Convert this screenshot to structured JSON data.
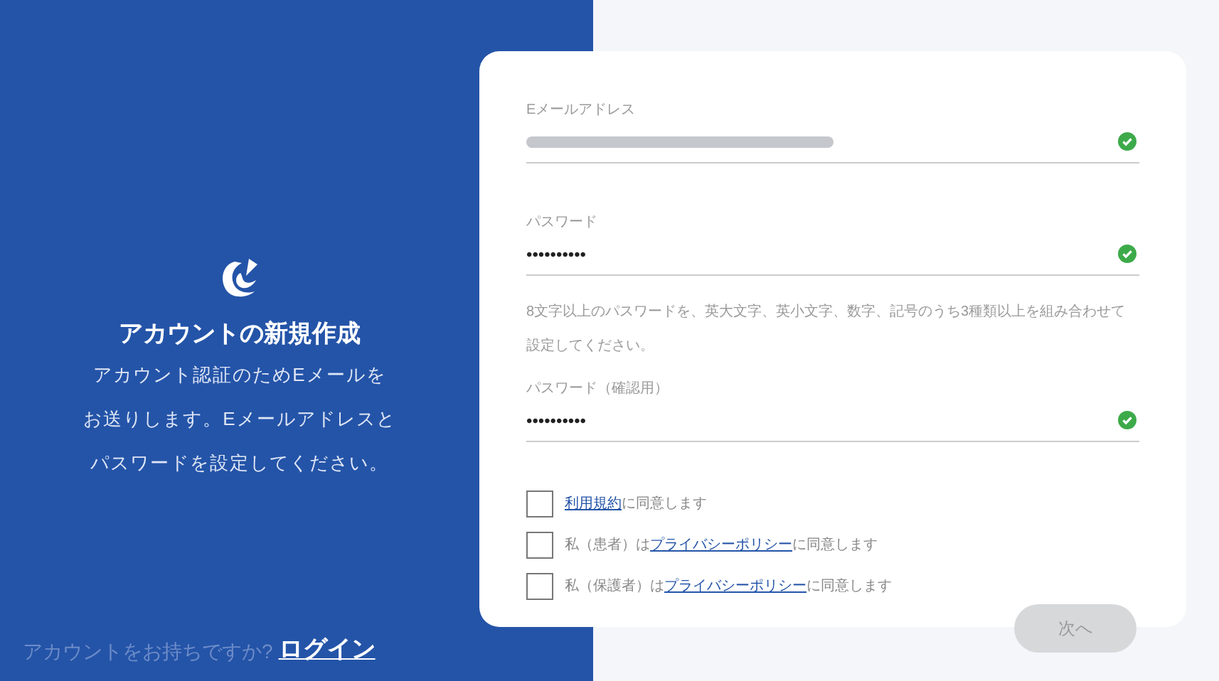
{
  "left_panel": {
    "title": "アカウントの新規作成",
    "description": [
      "アカウント認証のためEメールを",
      "お送りします。Eメールアドレスと",
      "パスワードを設定してください。"
    ],
    "login_prompt": "アカウントをお持ちですか?",
    "login_link": "ログイン"
  },
  "form": {
    "fields": [
      {
        "label": "Eメールアドレス",
        "valid": true
      },
      {
        "label": "パスワード",
        "value": "••••••••••",
        "valid": true,
        "help": "8文字以上のパスワードを、英大文字、英小文字、数字、記号のうち3種類以上を組み合わせて設定してください。"
      },
      {
        "label": "パスワード（確認用）",
        "value": "••••••••••",
        "valid": true
      }
    ],
    "agreements": [
      {
        "link": "利用規約",
        "suffix": "に同意します",
        "checked": false
      },
      {
        "prefix": "私（患者）は",
        "link": "プライバシーポリシー",
        "suffix": "に同意します",
        "checked": false
      },
      {
        "prefix": "私（保護者）は",
        "link": "プライバシーポリシー",
        "suffix": "に同意します",
        "checked": false
      }
    ],
    "next_button": {
      "label": "次へ",
      "disabled": true
    }
  }
}
